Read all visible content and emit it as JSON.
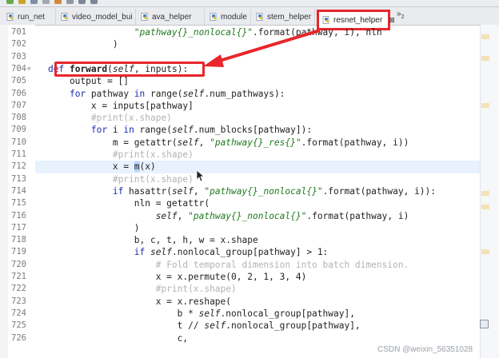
{
  "tabs": [
    {
      "label": "run_net",
      "icon": "python-file-icon"
    },
    {
      "label": "video_model_bui",
      "icon": "python-file-icon"
    },
    {
      "label": "ava_helper",
      "icon": "python-file-icon"
    },
    {
      "label": "module",
      "icon": "python-file-icon"
    },
    {
      "label": "stem_helper",
      "icon": "python-file-icon"
    },
    {
      "label": "resnet_helper",
      "icon": "python-file-icon",
      "active": true,
      "close": "⊠"
    }
  ],
  "overflow_tabs": {
    "label": "»",
    "count": "2"
  },
  "annotation_color": "#e8262b",
  "lines": [
    {
      "num": "701",
      "html": "                <span class=\"str\">\"pathway{}_nonlocal{}\"</span>.format(pathway, i), nln"
    },
    {
      "num": "702",
      "html": "            )"
    },
    {
      "num": "703",
      "html": ""
    },
    {
      "num": "704",
      "fold": "⊖",
      "html": "<span class=\"kw\">def</span> <span class=\"fn\">forward</span>(<span class=\"self\">self</span>, inputs):"
    },
    {
      "num": "705",
      "html": "    output = []"
    },
    {
      "num": "706",
      "html": "    <span class=\"kw\">for</span> pathway <span class=\"kw\">in</span> range(<span class=\"self\">self</span>.num_pathways):"
    },
    {
      "num": "707",
      "html": "        x = inputs[pathway]"
    },
    {
      "num": "708",
      "html": "        <span class=\"cm\">#print(x.shape)</span>"
    },
    {
      "num": "709",
      "html": "        <span class=\"kw\">for</span> i <span class=\"kw\">in</span> range(<span class=\"self\">self</span>.num_blocks[pathway]):"
    },
    {
      "num": "710",
      "html": "            m = getattr(<span class=\"self\">self</span>, <span class=\"str\">\"pathway{}_res{}\"</span>.format(pathway, i))"
    },
    {
      "num": "711",
      "html": "            <span class=\"cm\">#print(x.shape)</span>"
    },
    {
      "num": "712",
      "highlight": true,
      "html": "            x = <span class=\"caret-sel\">m</span>(x)"
    },
    {
      "num": "713",
      "html": "            <span class=\"cm\">#print(x.shape)</span>"
    },
    {
      "num": "714",
      "html": "            <span class=\"kw\">if</span> hasattr(<span class=\"self\">self</span>, <span class=\"str\">\"pathway{}_nonlocal{}\"</span>.format(pathway, i)):"
    },
    {
      "num": "715",
      "html": "                nln = getattr("
    },
    {
      "num": "716",
      "html": "                    <span class=\"self\">self</span>, <span class=\"str\">\"pathway{}_nonlocal{}\"</span>.format(pathway, i)"
    },
    {
      "num": "717",
      "html": "                )"
    },
    {
      "num": "718",
      "html": "                b, c, t, h, w = x.shape"
    },
    {
      "num": "719",
      "html": "                <span class=\"kw\">if</span> <span class=\"self\">self</span>.nonlocal_group[pathway] > 1:"
    },
    {
      "num": "720",
      "html": "                    <span class=\"cm\"># Fold temporal dimension into batch dimension.</span>"
    },
    {
      "num": "721",
      "html": "                    x = x.permute(0, 2, 1, 3, 4)"
    },
    {
      "num": "722",
      "html": "                    <span class=\"cm\">#print(x.shape)</span>"
    },
    {
      "num": "723",
      "html": "                    x = x.reshape("
    },
    {
      "num": "724",
      "html": "                        b * <span class=\"self\">self</span>.nonlocal_group[pathway],"
    },
    {
      "num": "725",
      "html": "                        t // <span class=\"self\">self</span>.nonlocal_group[pathway],"
    },
    {
      "num": "726",
      "html": "                        c,"
    }
  ],
  "watermark": "CSDN @weixin_56351028"
}
